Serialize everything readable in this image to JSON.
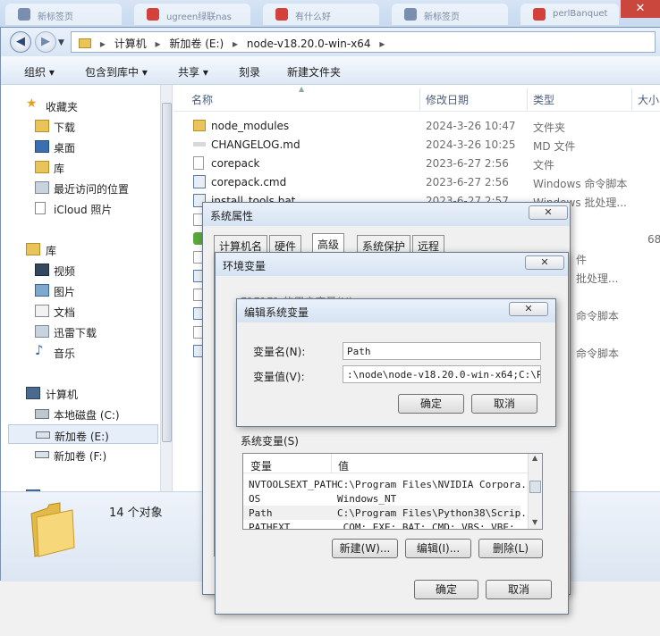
{
  "browser_tabs": [
    {
      "label": "新标签页",
      "color": "#7a8fb0"
    },
    {
      "label": "ugreen绿联nas",
      "color": "#d4403a"
    },
    {
      "label": "有什么好",
      "color": "#d4403a"
    },
    {
      "label": "新标签页",
      "color": "#7a8fb0"
    },
    {
      "label": "perlBanquet",
      "color": "#d4403a"
    }
  ],
  "browser": {
    "close_label": "✕"
  },
  "address": {
    "back_icon": "arrow-left-icon",
    "forward_icon": "arrow-right-icon",
    "crumbs": [
      "计算机",
      "新加卷 (E:)",
      "node-v18.20.0-win-x64"
    ],
    "separator": "▸"
  },
  "toolbar": {
    "organize": "组织 ▾",
    "include": "包含到库中 ▾",
    "share": "共享 ▾",
    "burn": "刻录",
    "new_folder": "新建文件夹"
  },
  "sidebar": {
    "favorites": "收藏夹",
    "fav_items": [
      "下载",
      "桌面",
      "库",
      "最近访问的位置",
      "iCloud 照片"
    ],
    "libraries": "库",
    "lib_items": [
      "视频",
      "图片",
      "文档",
      "迅雷下载",
      "音乐"
    ],
    "computer": "计算机",
    "drives": [
      "本地磁盘 (C:)",
      "新加卷 (E:)",
      "新加卷 (F:)"
    ],
    "network": "网络"
  },
  "columns": {
    "name": "名称",
    "date": "修改日期",
    "type": "类型",
    "size": "大小"
  },
  "files": [
    {
      "name": "node_modules",
      "date": "2024-3-26 10:47",
      "type": "文件夹",
      "kind": "folder"
    },
    {
      "name": "CHANGELOG.md",
      "date": "2024-3-26 10:25",
      "type": "MD 文件",
      "kind": "md"
    },
    {
      "name": "corepack",
      "date": "2023-6-27 2:56",
      "type": "文件",
      "kind": "file"
    },
    {
      "name": "corepack.cmd",
      "date": "2023-6-27 2:56",
      "type": "Windows 命令脚本",
      "kind": "cmd"
    },
    {
      "name": "install_tools.bat",
      "date": "2023-6-27 2:57",
      "type": "Windows 批处理...",
      "kind": "cmd"
    }
  ],
  "peek_texts": {
    "size_68": "68",
    "t1": "件",
    "t2": "批处理...",
    "t3": "命令脚本",
    "t4": "命令脚本"
  },
  "status": {
    "count": "14 个对象"
  },
  "sysprops": {
    "title": "系统属性",
    "tabs": [
      "计算机名",
      "硬件",
      "高级",
      "系统保护",
      "远程"
    ],
    "ok": "确定",
    "cancel": "取消"
  },
  "envvars": {
    "title": "环境变量",
    "user_vars_label": "F1F1F1 的用户变量(U)",
    "sys_vars_label": "系统变量(S)",
    "col_var": "变量",
    "col_val": "值",
    "sys_rows": [
      {
        "name": "NVTOOLSEXT_PATH",
        "value": "C:\\Program Files\\NVIDIA Corpora..."
      },
      {
        "name": "OS",
        "value": "Windows_NT"
      },
      {
        "name": "Path",
        "value": "C:\\Program Files\\Python38\\Scrip..."
      },
      {
        "name": "PATHEXT",
        "value": ".COM;.EXE;.BAT;.CMD;.VBS;.VBE;..."
      }
    ],
    "new_btn": "新建(W)...",
    "edit_btn": "编辑(I)...",
    "delete_btn": "删除(L)",
    "ok": "确定",
    "cancel": "取消"
  },
  "editvar": {
    "title": "编辑系统变量",
    "name_label": "变量名(N):",
    "name_value": "Path",
    "value_label": "变量值(V):",
    "value_value": ":\\node\\node-v18.20.0-win-x64;C:\\Pro",
    "ok": "确定",
    "cancel": "取消"
  }
}
